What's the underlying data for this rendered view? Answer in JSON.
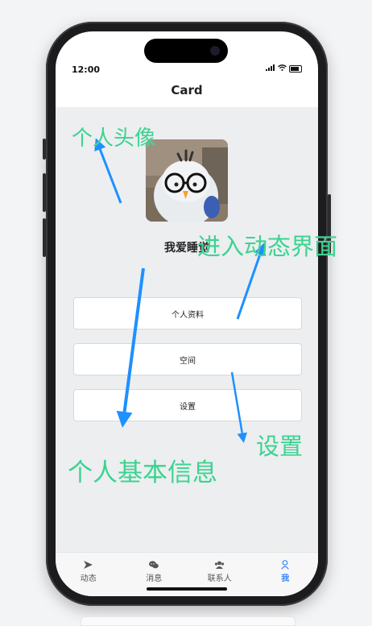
{
  "status": {
    "time": "12:00"
  },
  "nav": {
    "title": "Card"
  },
  "profile": {
    "username": "我爱睡觉"
  },
  "menu": [
    {
      "label": "个人资料"
    },
    {
      "label": "空间"
    },
    {
      "label": "设置"
    }
  ],
  "tabs": [
    {
      "label": "动态",
      "icon": "send-icon",
      "active": false
    },
    {
      "label": "消息",
      "icon": "chat-icon",
      "active": false
    },
    {
      "label": "联系人",
      "icon": "contacts-icon",
      "active": false
    },
    {
      "label": "我",
      "icon": "person-icon",
      "active": true
    }
  ],
  "annotations": {
    "avatar": "个人头像",
    "dynamic": "进入动态界面",
    "settings": "设置",
    "basic_info": "个人基本信息"
  },
  "colors": {
    "annotation": "#3bd38f",
    "arrow": "#1e90ff",
    "active_tab": "#3a86ff",
    "content_bg": "#eceef0"
  }
}
